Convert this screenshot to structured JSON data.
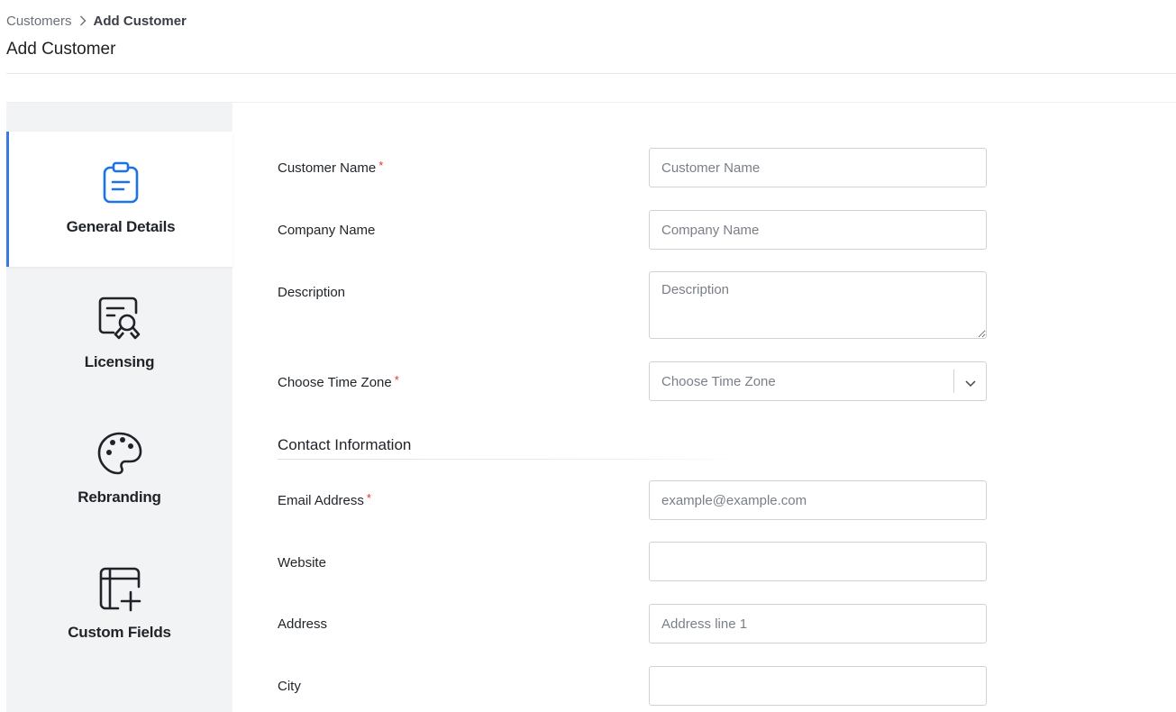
{
  "breadcrumb": {
    "parent": "Customers",
    "current": "Add Customer"
  },
  "page": {
    "title": "Add Customer"
  },
  "sidebar": {
    "items": [
      {
        "label": "General Details",
        "icon": "clipboard-icon",
        "active": true
      },
      {
        "label": "Licensing",
        "icon": "certificate-icon",
        "active": false
      },
      {
        "label": "Rebranding",
        "icon": "palette-icon",
        "active": false
      },
      {
        "label": "Custom Fields",
        "icon": "table-add-icon",
        "active": false
      }
    ]
  },
  "form": {
    "customer_name": {
      "label": "Customer Name",
      "required_mark": "*",
      "placeholder": "Customer Name",
      "value": ""
    },
    "company_name": {
      "label": "Company Name",
      "placeholder": "Company Name",
      "value": ""
    },
    "description": {
      "label": "Description",
      "placeholder": "Description",
      "value": ""
    },
    "time_zone": {
      "label": "Choose Time Zone",
      "required_mark": "*",
      "placeholder": "Choose Time Zone"
    },
    "contact_section_title": "Contact Information",
    "email": {
      "label": "Email Address",
      "required_mark": "*",
      "placeholder": "example@example.com",
      "value": ""
    },
    "website": {
      "label": "Website",
      "placeholder": "",
      "value": ""
    },
    "address": {
      "label": "Address",
      "placeholder": "Address line 1",
      "value": ""
    },
    "city": {
      "label": "City",
      "placeholder": "",
      "value": ""
    }
  },
  "colors": {
    "accent": "#3a7be0",
    "required": "#e0342a",
    "sidebar_bg": "#f2f3f5",
    "active_icon": "#1a73e8"
  }
}
